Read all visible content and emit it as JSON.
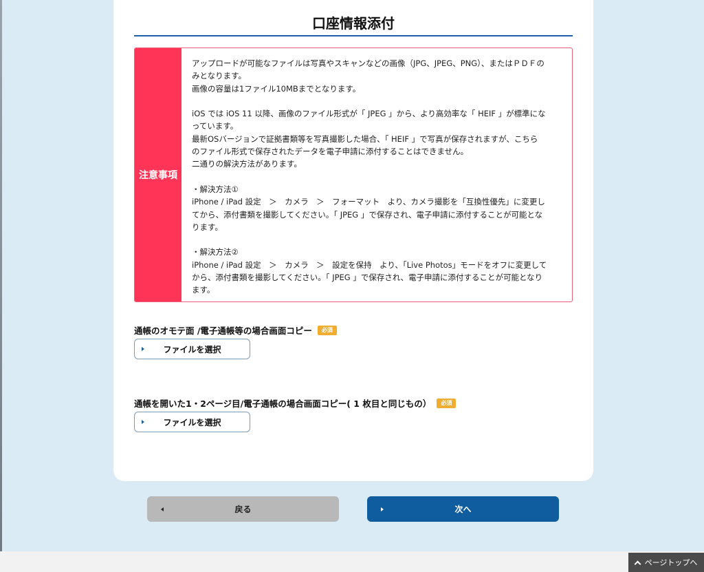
{
  "header": {
    "title": "口座情報添付"
  },
  "notice": {
    "label": "注意事項",
    "lines": [
      "アップロードが可能なファイルは写真やスキャンなどの画像（JPG、JPEG、PNG）、またはＰＤＦの",
      "みとなります。",
      "画像の容量は1ファイル10MBまでとなります。",
      "",
      "iOS では iOS 11 以降、画像のファイル形式が「 JPEG 」から、より高効率な「 HEIF 」が標準にな",
      "っています。",
      "最新OSバージョンで証拠書類等を写真撮影した場合、「 HEIF 」で写真が保存されますが、こちら",
      "のファイル形式で保存されたデータを電子申請に添付することはできません。",
      "二通りの解決方法があります。",
      "",
      "・解決方法①",
      "iPhone / iPad 設定　＞　カメラ　＞　フォーマット　より、カメラ撮影を「互換性優先」に変更し",
      "てから、添付書類を撮影してください。「 JPEG 」で保存され、電子申請に添付することが可能とな",
      "ります。",
      "",
      "・解決方法②",
      "iPhone / iPad 設定　＞　カメラ　＞　設定を保持　より、「Live Photos」モードをオフに変更して",
      "から、添付書類を撮影してください。「 JPEG 」で保存され、電子申請に添付することが可能となり",
      "ます。"
    ]
  },
  "upload1": {
    "label": "通帳のオモテ面 /電子通帳等の場合画面コピー",
    "badge": "必須",
    "button_label": "ファイルを選択"
  },
  "upload2": {
    "label": "通帳を開いた1・2ページ目/電子通帳の場合画面コピー( 1 枚目と同じもの）",
    "badge": "必須",
    "button_label": "ファイルを選択"
  },
  "nav": {
    "back_label": "戻る",
    "next_label": "次へ"
  },
  "pagetop": {
    "label": "ページトップへ"
  }
}
